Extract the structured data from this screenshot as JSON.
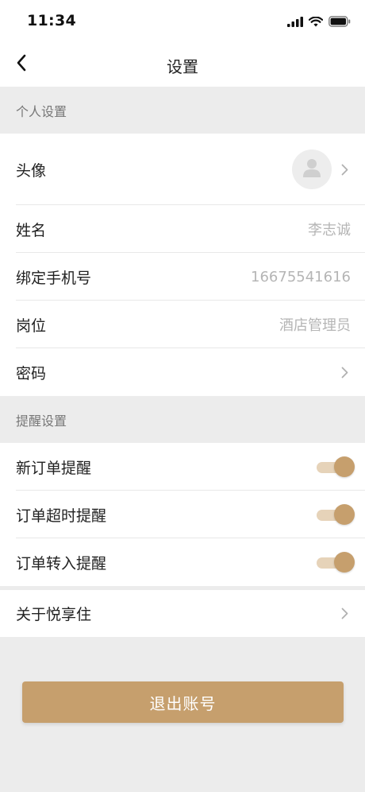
{
  "status_bar": {
    "time": "11:34"
  },
  "nav": {
    "title": "设置"
  },
  "sections": {
    "personal": {
      "label": "个人设置"
    },
    "reminders": {
      "label": "提醒设置"
    }
  },
  "rows": {
    "avatar": {
      "label": "头像"
    },
    "name": {
      "label": "姓名",
      "value": "李志诚"
    },
    "phone": {
      "label": "绑定手机号",
      "value": "16675541616"
    },
    "position": {
      "label": "岗位",
      "value": "酒店管理员"
    },
    "password": {
      "label": "密码"
    },
    "new_order": {
      "label": "新订单提醒",
      "enabled": true
    },
    "order_timeout": {
      "label": "订单超时提醒",
      "enabled": true
    },
    "order_transfer": {
      "label": "订单转入提醒",
      "enabled": true
    },
    "about": {
      "label": "关于悦享住"
    }
  },
  "logout": {
    "label": "退出账号"
  },
  "colors": {
    "accent": "#c69f6d",
    "accent_light": "#e6d3b9",
    "background": "#ececec"
  }
}
